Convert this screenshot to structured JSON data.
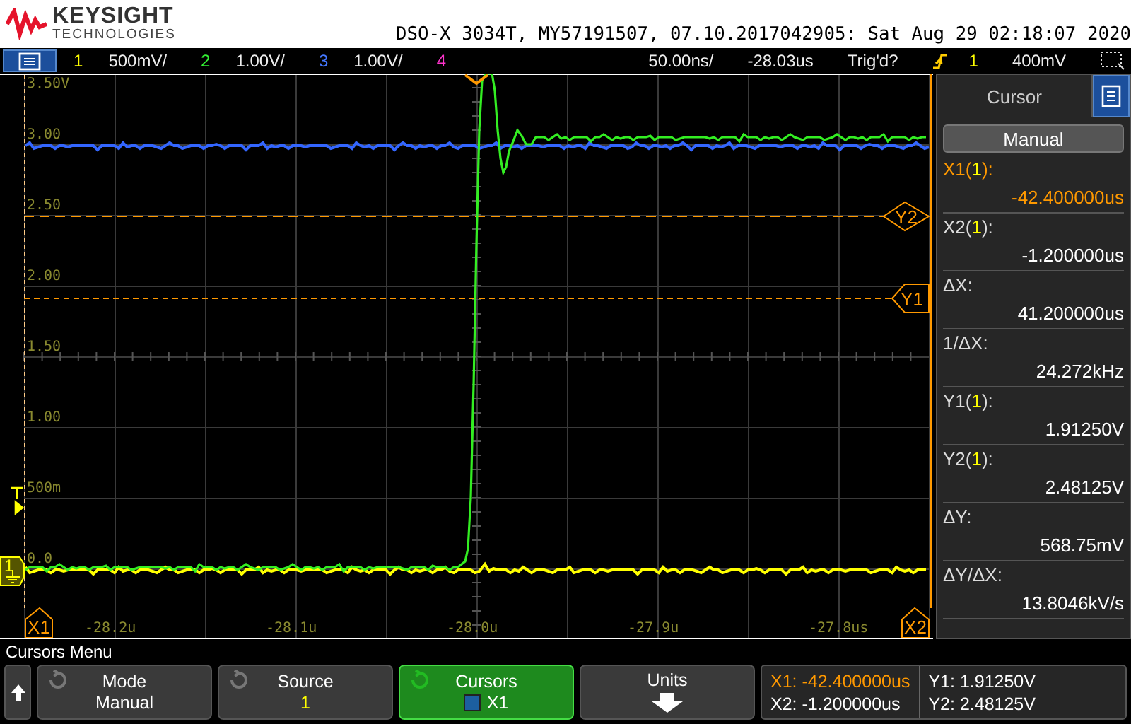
{
  "header": {
    "brand": "KEYSIGHT",
    "brand_sub": "TECHNOLOGIES",
    "title": "DSO-X 3034T, MY57191507, 07.10.2017042905: Sat Aug 29 02:18:07 2020"
  },
  "channel_bar": {
    "channels": [
      {
        "number": "1",
        "scale": "500mV/",
        "color": "#ffff00"
      },
      {
        "number": "2",
        "scale": "1.00V/",
        "color": "#33ee33"
      },
      {
        "number": "3",
        "scale": "1.00V/",
        "color": "#4477ff"
      },
      {
        "number": "4",
        "color": "#ff33cc"
      }
    ],
    "timebase": "50.00ns/",
    "delay": "-28.03us",
    "trigger_status": "Trig'd?",
    "trigger_source": "1",
    "trigger_level": "400mV"
  },
  "plot": {
    "y_labels": [
      "3.50V",
      "3.00",
      "2.50",
      "2.00",
      "1.50",
      "1.00",
      "500m",
      "0.0"
    ],
    "x_labels": [
      "-28.2u",
      "-28.1u",
      "-28.0u",
      "-27.9u",
      "-27.8us"
    ],
    "ground_marker": "1",
    "cursor_markers": [
      "Y2",
      "Y1",
      "X1",
      "X2"
    ]
  },
  "cursor_panel": {
    "tab": "Cursor",
    "mode": "Manual",
    "rows": [
      {
        "label": "X1(",
        "source": "1",
        "suffix": "):",
        "value": "-42.400000us",
        "selected": true
      },
      {
        "label": "X2(",
        "source": "1",
        "suffix": "):",
        "value": "-1.200000us",
        "selected": false
      },
      {
        "label": "ΔX:",
        "value": "41.200000us",
        "selected": false
      },
      {
        "label": "1/ΔX:",
        "value": "24.272kHz",
        "selected": false
      },
      {
        "label": "Y1(",
        "source": "1",
        "suffix": "):",
        "value": "1.91250V",
        "selected": false
      },
      {
        "label": "Y2(",
        "source": "1",
        "suffix": "):",
        "value": "2.48125V",
        "selected": false
      },
      {
        "label": "ΔY:",
        "value": "568.75mV",
        "selected": false
      },
      {
        "label": "ΔY/ΔX:",
        "value": "13.8046kV/s",
        "selected": false
      }
    ]
  },
  "softkey_menu": {
    "title": "Cursors Menu",
    "keys": [
      {
        "kind": "mode",
        "title": "Mode",
        "value": "Manual",
        "selected": false
      },
      {
        "kind": "channel",
        "title": "Source",
        "value": "1",
        "selected": false
      },
      {
        "kind": "cursor",
        "title": "Cursors",
        "value": "X1",
        "selected": true
      },
      {
        "kind": "units",
        "title": "Units",
        "selected": false
      }
    ],
    "readouts": [
      {
        "text": "X1: -42.400000us",
        "selected": true
      },
      {
        "text": "X2: -1.200000us",
        "selected": false
      },
      {
        "text": "Y1: 1.91250V",
        "selected": false
      },
      {
        "text": "Y2: 2.48125V",
        "selected": false
      }
    ]
  }
}
